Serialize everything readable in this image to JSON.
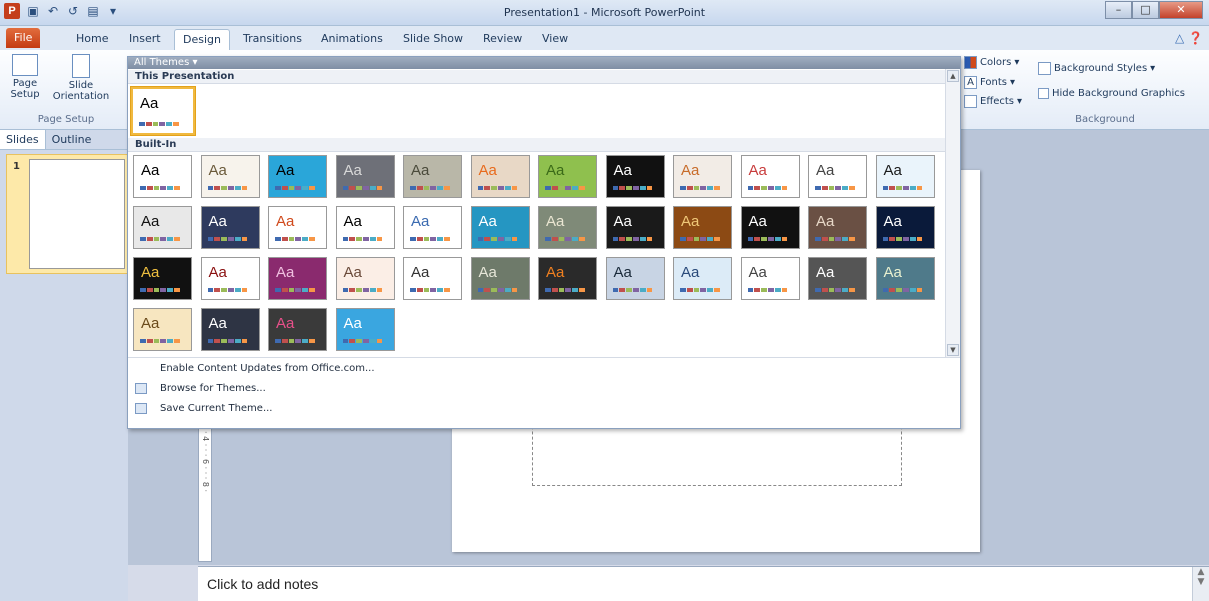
{
  "window": {
    "title": "Presentation1 - Microsoft PowerPoint",
    "app_icon": "P"
  },
  "ribbon_tabs": [
    "File",
    "Home",
    "Insert",
    "Design",
    "Transitions",
    "Animations",
    "Slide Show",
    "Review",
    "View"
  ],
  "active_tab": "Design",
  "ribbon": {
    "page_setup_label": "Page Setup",
    "page_setup_btn": "Page Setup",
    "slide_orientation_btn": "Slide Orientation",
    "colors": "Colors",
    "fonts": "Fonts",
    "effects": "Effects",
    "background_styles": "Background Styles",
    "hide_background_graphics": "Hide Background Graphics",
    "background_label": "Background"
  },
  "left_panel": {
    "tabs": [
      "Slides",
      "Outline"
    ],
    "slide_number": "1"
  },
  "gallery": {
    "header": "All Themes ▾",
    "this_presentation": "This Presentation",
    "built_in": "Built-In",
    "current_theme_text": "Aa",
    "menu": [
      "Enable Content Updates from Office.com...",
      "Browse for Themes...",
      "Save Current Theme..."
    ]
  },
  "themes": [
    {
      "text": "Aa",
      "bg": "#ffffff",
      "fg": "#000000"
    },
    {
      "text": "Aa",
      "bg": "#f7f3ec",
      "fg": "#6b5a3a"
    },
    {
      "text": "Aa",
      "bg": "#2aa6d9",
      "fg": "#000000"
    },
    {
      "text": "Aa",
      "bg": "#6e7078",
      "fg": "#d8d8d8"
    },
    {
      "text": "Aa",
      "bg": "#b9b7a8",
      "fg": "#4a4a3a"
    },
    {
      "text": "Aa",
      "bg": "#e8d8c6",
      "fg": "#e86a1c"
    },
    {
      "text": "Aa",
      "bg": "#8fc04e",
      "fg": "#3a6a18"
    },
    {
      "text": "Aa",
      "bg": "#111111",
      "fg": "#ffffff"
    },
    {
      "text": "Aa",
      "bg": "#f2ece6",
      "fg": "#c86c2a"
    },
    {
      "text": "Aa",
      "bg": "#ffffff",
      "fg": "#c83c3c"
    },
    {
      "text": "Aa",
      "bg": "#ffffff",
      "fg": "#444444"
    },
    {
      "text": "Aa",
      "bg": "#eaf4fb",
      "fg": "#1a1a1a"
    },
    {
      "text": "Aa",
      "bg": "#e8e8e8",
      "fg": "#111111"
    },
    {
      "text": "Aa",
      "bg": "#2e3a5e",
      "fg": "#ffffff"
    },
    {
      "text": "Aa",
      "bg": "#ffffff",
      "fg": "#d04a1c"
    },
    {
      "text": "Aa",
      "bg": "#ffffff",
      "fg": "#000000"
    },
    {
      "text": "Aa",
      "bg": "#ffffff",
      "fg": "#3a6ab0"
    },
    {
      "text": "Aa",
      "bg": "#2596c2",
      "fg": "#ffffff"
    },
    {
      "text": "Aa",
      "bg": "#7f8a78",
      "fg": "#eae6d2"
    },
    {
      "text": "Aa",
      "bg": "#1a1a1a",
      "fg": "#ffffff"
    },
    {
      "text": "Aa",
      "bg": "#8c4a14",
      "fg": "#f0c878"
    },
    {
      "text": "Aa",
      "bg": "#111111",
      "fg": "#ffffff"
    },
    {
      "text": "Aa",
      "bg": "#6a5044",
      "fg": "#e8d8c8"
    },
    {
      "text": "Aa",
      "bg": "#0a1a3a",
      "fg": "#ffffff"
    },
    {
      "text": "Aa",
      "bg": "#111111",
      "fg": "#f0c040"
    },
    {
      "text": "Aa",
      "bg": "#ffffff",
      "fg": "#8a1010"
    },
    {
      "text": "Aa",
      "bg": "#8a2a6e",
      "fg": "#f0c0e0"
    },
    {
      "text": "Aa",
      "bg": "#fbeee6",
      "fg": "#6a4a3a"
    },
    {
      "text": "Aa",
      "bg": "#ffffff",
      "fg": "#333333"
    },
    {
      "text": "Aa",
      "bg": "#6e7a6a",
      "fg": "#e6e6d8"
    },
    {
      "text": "Aa",
      "bg": "#2a2a2a",
      "fg": "#f08020"
    },
    {
      "text": "Aa",
      "bg": "#c8d4e4",
      "fg": "#1a2a3a"
    },
    {
      "text": "Aa",
      "bg": "#dcebf7",
      "fg": "#2a4a7a"
    },
    {
      "text": "Aa",
      "bg": "#ffffff",
      "fg": "#444444"
    },
    {
      "text": "Aa",
      "bg": "#555555",
      "fg": "#ffffff"
    },
    {
      "text": "Aa",
      "bg": "#4f7a8a",
      "fg": "#e8f0d0"
    },
    {
      "text": "Aa",
      "bg": "#f7e6c0",
      "fg": "#6a4a1a"
    },
    {
      "text": "Aa",
      "bg": "#2e3444",
      "fg": "#ffffff"
    },
    {
      "text": "Aa",
      "bg": "#3a3a3a",
      "fg": "#e8508a"
    },
    {
      "text": "Aa",
      "bg": "#3aa6e0",
      "fg": "#ffffff"
    }
  ],
  "swatch_colors": [
    "#3f6ab0",
    "#c0504d",
    "#9bbb59",
    "#8064a2",
    "#4bacc6",
    "#f79646"
  ],
  "notes": {
    "placeholder": "Click to add notes"
  },
  "ruler_marks": "· 4 · · · 6 · · · 8 ·"
}
